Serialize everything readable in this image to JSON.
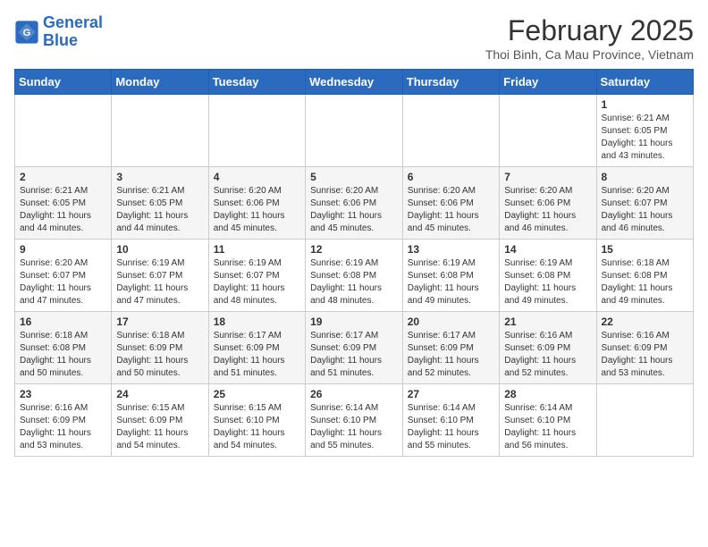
{
  "header": {
    "logo_general": "General",
    "logo_blue": "Blue",
    "month_title": "February 2025",
    "location": "Thoi Binh, Ca Mau Province, Vietnam"
  },
  "weekdays": [
    "Sunday",
    "Monday",
    "Tuesday",
    "Wednesday",
    "Thursday",
    "Friday",
    "Saturday"
  ],
  "weeks": [
    [
      {
        "day": "",
        "info": ""
      },
      {
        "day": "",
        "info": ""
      },
      {
        "day": "",
        "info": ""
      },
      {
        "day": "",
        "info": ""
      },
      {
        "day": "",
        "info": ""
      },
      {
        "day": "",
        "info": ""
      },
      {
        "day": "1",
        "info": "Sunrise: 6:21 AM\nSunset: 6:05 PM\nDaylight: 11 hours\nand 43 minutes."
      }
    ],
    [
      {
        "day": "2",
        "info": "Sunrise: 6:21 AM\nSunset: 6:05 PM\nDaylight: 11 hours\nand 44 minutes."
      },
      {
        "day": "3",
        "info": "Sunrise: 6:21 AM\nSunset: 6:05 PM\nDaylight: 11 hours\nand 44 minutes."
      },
      {
        "day": "4",
        "info": "Sunrise: 6:20 AM\nSunset: 6:06 PM\nDaylight: 11 hours\nand 45 minutes."
      },
      {
        "day": "5",
        "info": "Sunrise: 6:20 AM\nSunset: 6:06 PM\nDaylight: 11 hours\nand 45 minutes."
      },
      {
        "day": "6",
        "info": "Sunrise: 6:20 AM\nSunset: 6:06 PM\nDaylight: 11 hours\nand 45 minutes."
      },
      {
        "day": "7",
        "info": "Sunrise: 6:20 AM\nSunset: 6:06 PM\nDaylight: 11 hours\nand 46 minutes."
      },
      {
        "day": "8",
        "info": "Sunrise: 6:20 AM\nSunset: 6:07 PM\nDaylight: 11 hours\nand 46 minutes."
      }
    ],
    [
      {
        "day": "9",
        "info": "Sunrise: 6:20 AM\nSunset: 6:07 PM\nDaylight: 11 hours\nand 47 minutes."
      },
      {
        "day": "10",
        "info": "Sunrise: 6:19 AM\nSunset: 6:07 PM\nDaylight: 11 hours\nand 47 minutes."
      },
      {
        "day": "11",
        "info": "Sunrise: 6:19 AM\nSunset: 6:07 PM\nDaylight: 11 hours\nand 48 minutes."
      },
      {
        "day": "12",
        "info": "Sunrise: 6:19 AM\nSunset: 6:08 PM\nDaylight: 11 hours\nand 48 minutes."
      },
      {
        "day": "13",
        "info": "Sunrise: 6:19 AM\nSunset: 6:08 PM\nDaylight: 11 hours\nand 49 minutes."
      },
      {
        "day": "14",
        "info": "Sunrise: 6:19 AM\nSunset: 6:08 PM\nDaylight: 11 hours\nand 49 minutes."
      },
      {
        "day": "15",
        "info": "Sunrise: 6:18 AM\nSunset: 6:08 PM\nDaylight: 11 hours\nand 49 minutes."
      }
    ],
    [
      {
        "day": "16",
        "info": "Sunrise: 6:18 AM\nSunset: 6:08 PM\nDaylight: 11 hours\nand 50 minutes."
      },
      {
        "day": "17",
        "info": "Sunrise: 6:18 AM\nSunset: 6:09 PM\nDaylight: 11 hours\nand 50 minutes."
      },
      {
        "day": "18",
        "info": "Sunrise: 6:17 AM\nSunset: 6:09 PM\nDaylight: 11 hours\nand 51 minutes."
      },
      {
        "day": "19",
        "info": "Sunrise: 6:17 AM\nSunset: 6:09 PM\nDaylight: 11 hours\nand 51 minutes."
      },
      {
        "day": "20",
        "info": "Sunrise: 6:17 AM\nSunset: 6:09 PM\nDaylight: 11 hours\nand 52 minutes."
      },
      {
        "day": "21",
        "info": "Sunrise: 6:16 AM\nSunset: 6:09 PM\nDaylight: 11 hours\nand 52 minutes."
      },
      {
        "day": "22",
        "info": "Sunrise: 6:16 AM\nSunset: 6:09 PM\nDaylight: 11 hours\nand 53 minutes."
      }
    ],
    [
      {
        "day": "23",
        "info": "Sunrise: 6:16 AM\nSunset: 6:09 PM\nDaylight: 11 hours\nand 53 minutes."
      },
      {
        "day": "24",
        "info": "Sunrise: 6:15 AM\nSunset: 6:09 PM\nDaylight: 11 hours\nand 54 minutes."
      },
      {
        "day": "25",
        "info": "Sunrise: 6:15 AM\nSunset: 6:10 PM\nDaylight: 11 hours\nand 54 minutes."
      },
      {
        "day": "26",
        "info": "Sunrise: 6:14 AM\nSunset: 6:10 PM\nDaylight: 11 hours\nand 55 minutes."
      },
      {
        "day": "27",
        "info": "Sunrise: 6:14 AM\nSunset: 6:10 PM\nDaylight: 11 hours\nand 55 minutes."
      },
      {
        "day": "28",
        "info": "Sunrise: 6:14 AM\nSunset: 6:10 PM\nDaylight: 11 hours\nand 56 minutes."
      },
      {
        "day": "",
        "info": ""
      }
    ]
  ]
}
